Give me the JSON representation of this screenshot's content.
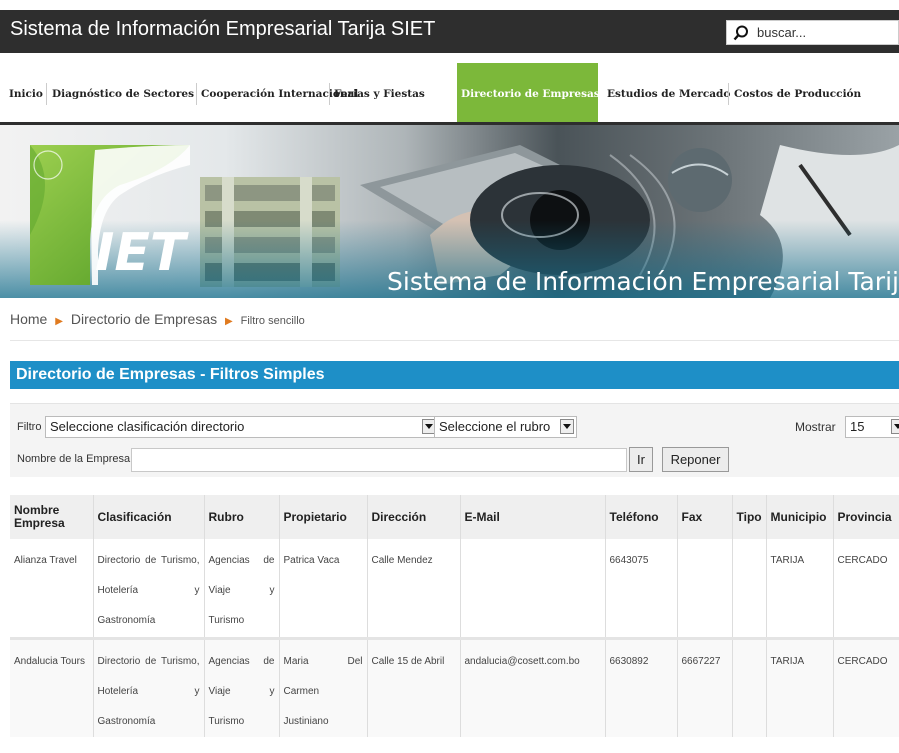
{
  "header": {
    "site_title": "Sistema de Información Empresarial Tarija SIET",
    "search_placeholder": "buscar..."
  },
  "nav": {
    "items": [
      {
        "label": "Inicio"
      },
      {
        "label": "Diagnóstico de Sectores"
      },
      {
        "label": "Cooperación Internacional"
      },
      {
        "label": "Ferias y Fiestas"
      },
      {
        "label": "Directorio de Empresas",
        "active": true
      },
      {
        "label": "Estudios de Mercado"
      },
      {
        "label": "Costos de Producción"
      }
    ]
  },
  "banner": {
    "logo_text": "IET",
    "subtitle": "Sistema de Información Empresarial Tarija"
  },
  "breadcrumb": {
    "home": "Home",
    "section": "Directorio de Empresas",
    "current": "Filtro sencillo"
  },
  "section": {
    "title": "Directorio de Empresas - Filtros Simples"
  },
  "filters": {
    "filtro_label": "Filtro",
    "clasificacion_value": "Seleccione clasificación directorio",
    "rubro_value": "Seleccione el rubro",
    "mostrar_label": "Mostrar",
    "mostrar_value": "15",
    "nombre_label": "Nombre de la Empresa",
    "ir_label": "Ir",
    "reponer_label": "Reponer"
  },
  "table": {
    "headers": [
      "Nombre Empresa",
      "Clasificación",
      "Rubro",
      "Propietario",
      "Dirección",
      "E-Mail",
      "Teléfono",
      "Fax",
      "Tipo",
      "Municipio",
      "Provincia"
    ],
    "rows": [
      [
        "Alianza Travel",
        "Directorio de Turismo, Hotelería y Gastronomía",
        "Agencias de Viaje y Turismo",
        "Patrica Vaca",
        "Calle Mendez",
        "",
        "6643075",
        "",
        "",
        "TARIJA",
        "CERCADO"
      ],
      [
        "Andalucia Tours",
        "Directorio de Turismo, Hotelería y Gastronomía",
        "Agencias de Viaje y Turismo",
        "Maria Del Carmen Justiniano",
        "Calle 15 de Abril",
        "andalucia@cosett.com.bo",
        "6630892",
        "6667227",
        "",
        "TARIJA",
        "CERCADO"
      ]
    ]
  },
  "colors": {
    "accent_green": "#7cb83a",
    "title_bar": "#2e2e2e",
    "section_blue": "#1e8fc7"
  }
}
